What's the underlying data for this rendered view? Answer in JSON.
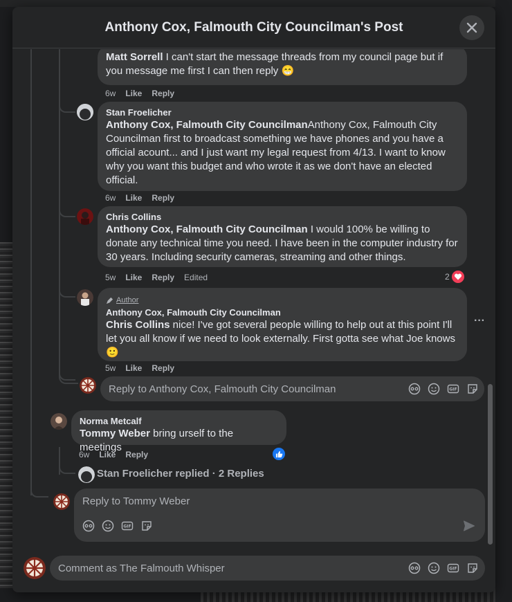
{
  "modal": {
    "title": "Anthony Cox, Falmouth City Councilman's Post"
  },
  "comments": {
    "matt_reply": {
      "mention": "Matt Sorrell",
      "text": " I can't start the message threads from my council page but if you message me first I can then reply 😁",
      "time": "6w",
      "like": "Like",
      "reply": "Reply"
    },
    "stan": {
      "author": "Stan Froelicher",
      "mention": "Anthony Cox, Falmouth City Councilman",
      "text": "Anthony Cox, Falmouth City Councilman first to broadcast something we have phones and you have a official acount... and I just want my legal request from 4/13. I want to know why you want this budget and who wrote it as we don't have an elected official.",
      "time": "6w",
      "like": "Like",
      "reply": "Reply"
    },
    "chris": {
      "author": "Chris Collins",
      "mention": "Anthony Cox, Falmouth City Councilman",
      "text": " I would 100% be willing to donate any technical time you need. I have been in the computer industry for 30 years. Including security cameras, streaming and other things.",
      "time": "5w",
      "like": "Like",
      "reply": "Reply",
      "edited": "Edited",
      "reaction_count": "2"
    },
    "anthony": {
      "badge": "Author",
      "author": "Anthony Cox, Falmouth City Councilman",
      "mention": "Chris Collins",
      "text": " nice! I've got several people willing to help out at this point I'll let you all know if we need to look externally. First gotta see what Joe knows 🙂",
      "time": "5w",
      "like": "Like",
      "reply": "Reply",
      "more": "···"
    },
    "reply_to_anthony": {
      "placeholder": "Reply to Anthony Cox, Falmouth City Councilman"
    },
    "norma": {
      "author": "Norma Metcalf",
      "mention": "Tommy Weber",
      "text": " bring urself to the meetings",
      "time": "6w",
      "like": "Like",
      "reply": "Reply"
    },
    "stan_replied": {
      "text": "Stan Froelicher replied · 2 Replies"
    },
    "reply_to_tommy": {
      "placeholder": "Reply to Tommy Weber"
    }
  },
  "footer": {
    "placeholder": "Comment as The Falmouth Whisper"
  },
  "icons": [
    "close-icon",
    "avatar-icon",
    "emoji-icon",
    "gif-icon",
    "sticker-icon",
    "send-icon",
    "heart-reaction-icon",
    "like-reaction-icon",
    "author-badge-icon",
    "more-icon"
  ],
  "colors": {
    "accent": "#1877f2",
    "heart": "#f33e58",
    "bubble": "#3a3b3c",
    "panel": "#242526"
  }
}
